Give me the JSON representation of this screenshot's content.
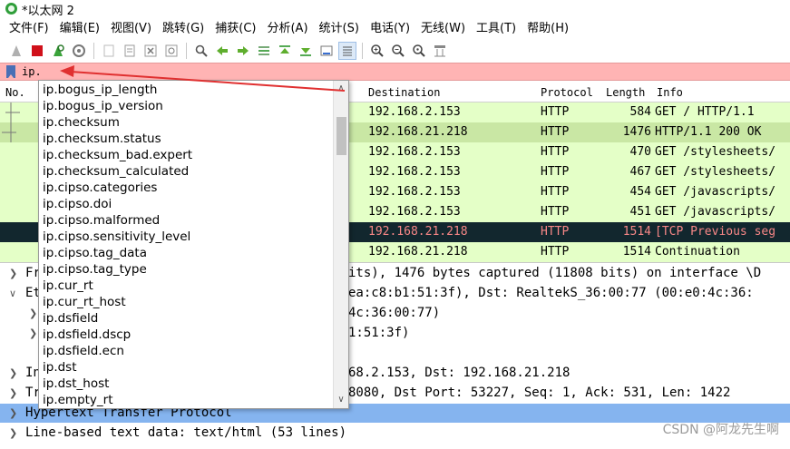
{
  "window": {
    "title": "*以太网 2"
  },
  "menu": [
    "文件(F)",
    "编辑(E)",
    "视图(V)",
    "跳转(G)",
    "捕获(C)",
    "分析(A)",
    "统计(S)",
    "电话(Y)",
    "无线(W)",
    "工具(T)",
    "帮助(H)"
  ],
  "filter": {
    "value": "ip."
  },
  "packet_list": {
    "columns": {
      "no": "No.",
      "destination": "Destination",
      "protocol": "Protocol",
      "length": "Length",
      "info": "Info"
    },
    "rows": [
      {
        "destination": "192.168.2.153",
        "protocol": "HTTP",
        "length": "584",
        "info": "GET / HTTP/1.1"
      },
      {
        "destination": "192.168.21.218",
        "protocol": "HTTP",
        "length": "1476",
        "info": "HTTP/1.1 200 OK"
      },
      {
        "destination": "192.168.2.153",
        "protocol": "HTTP",
        "length": "470",
        "info": "GET /stylesheets/"
      },
      {
        "destination": "192.168.2.153",
        "protocol": "HTTP",
        "length": "467",
        "info": "GET /stylesheets/"
      },
      {
        "destination": "192.168.2.153",
        "protocol": "HTTP",
        "length": "454",
        "info": "GET /javascripts/"
      },
      {
        "destination": "192.168.2.153",
        "protocol": "HTTP",
        "length": "451",
        "info": "GET /javascripts/"
      },
      {
        "destination": "192.168.21.218",
        "protocol": "HTTP",
        "length": "1514",
        "info": "[TCP Previous seg"
      },
      {
        "destination": "192.168.21.218",
        "protocol": "HTTP",
        "length": "1514",
        "info": "Continuation"
      }
    ]
  },
  "details": [
    {
      "prefix": "Fr",
      "text": "its), 1476 bytes captured (11808 bits) on interface \\D"
    },
    {
      "prefix": "Et",
      "text": "ea:c8:b1:51:3f), Dst: RealtekS_36:00:77 (00:e0:4c:36:"
    },
    {
      "text": "4c:36:00:77)"
    },
    {
      "text": "1:51:3f)"
    },
    {
      "prefix": "In",
      "text": "68.2.153, Dst: 192.168.21.218"
    },
    {
      "prefix": "Tr",
      "text": "8080, Dst Port: 53227, Seq: 1, Ack: 531, Len: 1422"
    },
    {
      "text": "Hypertext Transfer Protocol"
    },
    {
      "text": "Line-based text data: text/html (53 lines)"
    }
  ],
  "autocomplete": [
    "ip.bogus_ip_length",
    "ip.bogus_ip_version",
    "ip.checksum",
    "ip.checksum.status",
    "ip.checksum_bad.expert",
    "ip.checksum_calculated",
    "ip.cipso.categories",
    "ip.cipso.doi",
    "ip.cipso.malformed",
    "ip.cipso.sensitivity_level",
    "ip.cipso.tag_data",
    "ip.cipso.tag_type",
    "ip.cur_rt",
    "ip.cur_rt_host",
    "ip.dsfield",
    "ip.dsfield.dscp",
    "ip.dsfield.ecn",
    "ip.dst",
    "ip.dst_host",
    "ip.empty_rt"
  ],
  "watermark": "CSDN @阿龙先生啊",
  "colors": {
    "filter_invalid": "#ffb4b4",
    "http_row": "#e4ffc7",
    "tcp_bad_row": "#12272e",
    "selected_detail": "#85b4ef",
    "annotation": "#e03030"
  }
}
